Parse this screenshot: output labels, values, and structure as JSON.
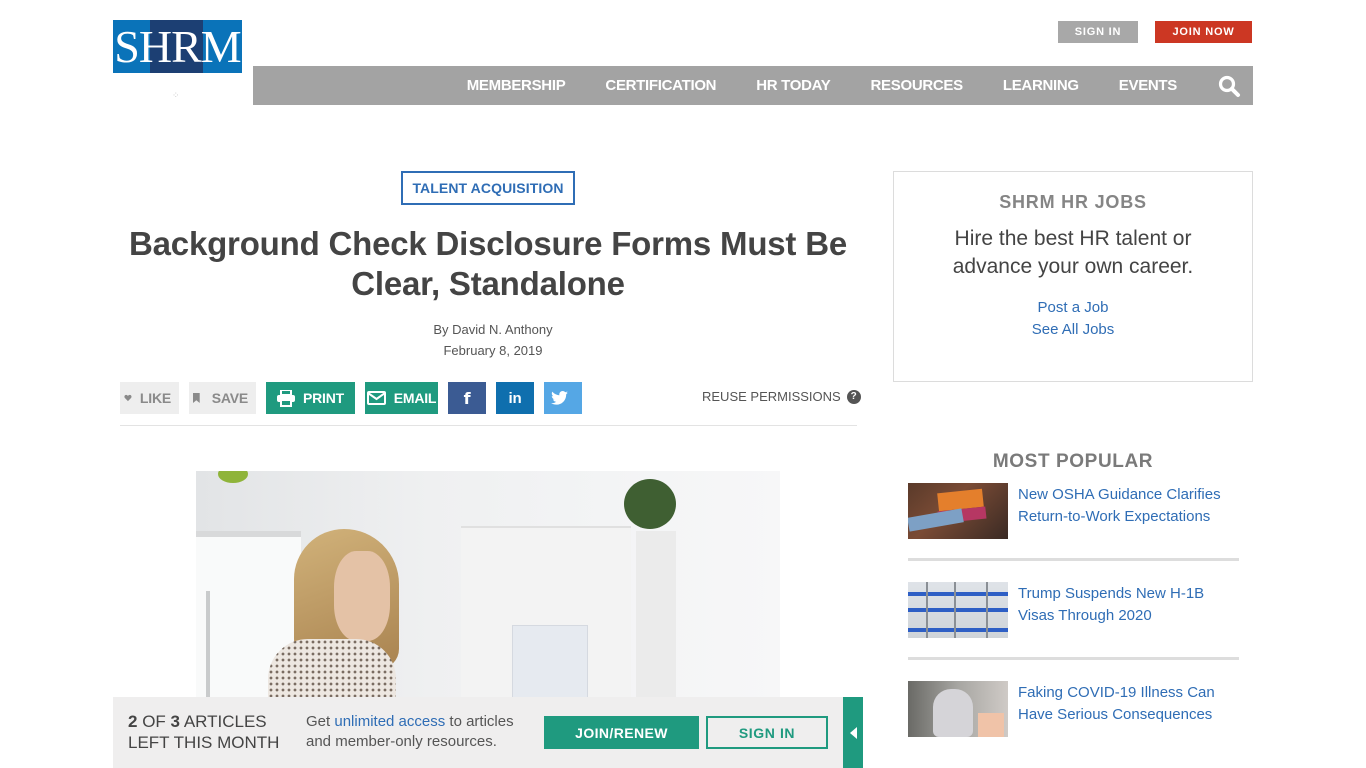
{
  "logo": {
    "text_s": "S",
    "text_hr": "HR",
    "text_m": "M",
    "alt": "SHRM"
  },
  "header": {
    "sign_in": "SIGN IN",
    "join_now": "JOIN NOW",
    "nav": [
      "MEMBERSHIP",
      "CERTIFICATION",
      "HR TODAY",
      "RESOURCES",
      "LEARNING",
      "EVENTS"
    ],
    "search_icon": "search-icon"
  },
  "article": {
    "category": "TALENT ACQUISITION",
    "title": "Background Check Disclosure Forms Must Be Clear, Standalone",
    "byline": "By David N. Anthony",
    "date": "February 8, 2019",
    "actions": {
      "like": "LIKE",
      "save": "SAVE",
      "print": "PRINT",
      "email": "EMAIL",
      "facebook": "f",
      "linkedin": "in",
      "reuse_permissions": "REUSE PERMISSIONS",
      "help": "?"
    }
  },
  "sidebar": {
    "jobs": {
      "title": "SHRM HR JOBS",
      "description": "Hire the best HR talent or advance your own career.",
      "links": [
        "Post a Job",
        "See All Jobs"
      ]
    },
    "most_popular": {
      "title": "MOST POPULAR",
      "items": [
        {
          "title": "New OSHA Guidance Clarifies Return-to-Work Expectations"
        },
        {
          "title": "Trump Suspends New H-1B Visas Through 2020"
        },
        {
          "title": "Faking COVID-19 Illness Can Have Serious Consequences"
        }
      ]
    }
  },
  "paywall": {
    "count_used": "2",
    "count_of": "OF",
    "count_total": "3",
    "count_suffix": "ARTICLES",
    "count_line2": "LEFT THIS MONTH",
    "msg_prefix": "Get ",
    "msg_link": "unlimited access",
    "msg_suffix": " to articles and member-only resources.",
    "join_renew": "JOIN/RENEW",
    "sign_in": "SIGN IN"
  },
  "colors": {
    "brand_blue": "#0a73b9",
    "brand_navy": "#1c3f73",
    "join_red": "#cc3723",
    "nav_gray": "#a3a3a3",
    "teal": "#1f9a7f",
    "link_blue": "#2f6db5",
    "facebook": "#3b5b93",
    "linkedin": "#0f6fae",
    "twitter": "#55a7e5"
  }
}
